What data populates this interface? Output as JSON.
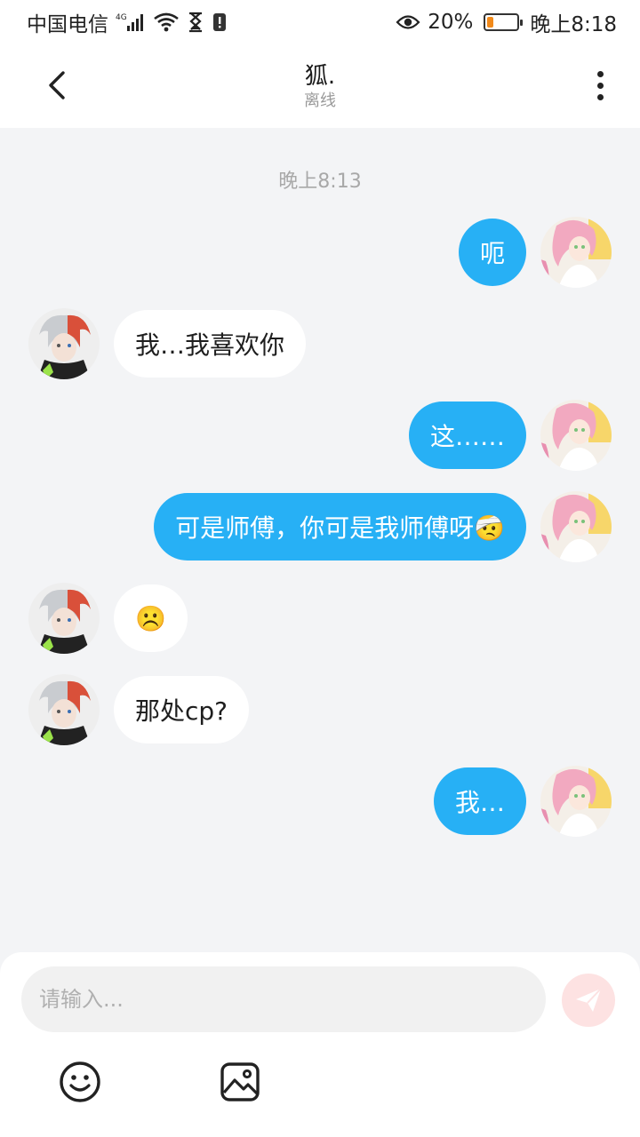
{
  "status_bar": {
    "carrier": "中国电信",
    "network": "4G",
    "battery_percent": "20%",
    "battery_level": 0.2,
    "time": "晚上8:18"
  },
  "header": {
    "title": "狐.",
    "status": "离线"
  },
  "conversation": {
    "timestamp": "晚上8:13",
    "messages": [
      {
        "side": "right",
        "text": "呃"
      },
      {
        "side": "left",
        "text": "我…我喜欢你"
      },
      {
        "side": "right",
        "text": "这……"
      },
      {
        "side": "right",
        "text": "可是师傅，你可是我师傅呀🤕"
      },
      {
        "side": "left",
        "text": "☹️"
      },
      {
        "side": "left",
        "text": "那处cp?"
      },
      {
        "side": "right",
        "text": "我…"
      }
    ]
  },
  "composer": {
    "placeholder": "请输入..."
  },
  "colors": {
    "accent": "#27b0f5",
    "send_button_bg": "#fde2e2",
    "background": "#f3f4f6"
  },
  "icons": {
    "back": "chevron-left-icon",
    "more": "more-vertical-icon",
    "send": "paper-plane-icon",
    "emoji": "smiley-icon",
    "image": "image-icon"
  }
}
